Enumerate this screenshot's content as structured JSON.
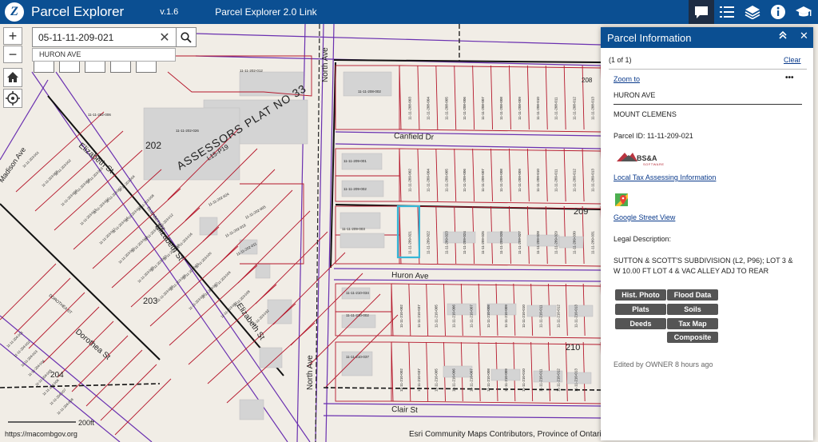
{
  "header": {
    "logo_letter": "Z",
    "title": "Parcel Explorer",
    "version": "v.1.6",
    "link_label": "Parcel Explorer 2.0 Link",
    "icons": [
      "chat-icon",
      "list-icon",
      "layers-icon",
      "info-icon",
      "graduation-cap-icon"
    ]
  },
  "search": {
    "value": "05-11-11-209-021",
    "suggestion": "HURON AVE"
  },
  "map": {
    "streets": [
      "North Ave",
      "Canfield Dr",
      "Huron Ave",
      "Clair St",
      "Elizabeth St",
      "Elizabeth St",
      "Dorothea St",
      "Madison Ave",
      "North Ave",
      "ELIZABETH ST",
      "DOROTHEA ST"
    ],
    "plat_label": "ASSESSORS PLAT NO 33",
    "plat_ref": "L15-P19",
    "block_numbers": [
      "202",
      "203",
      "204",
      "208",
      "209",
      "210"
    ],
    "scale_label": "200ft",
    "attribution_left": "https://macombgov.org",
    "attribution_right": "Esri Community Maps Contributors, Province of Ontari",
    "parcel_ids": {
      "block208": [
        "11-11-208-002",
        "11-11-208-003",
        "11-11-208-004",
        "11-11-208-005",
        "11-11-208-006",
        "11-11-208-007",
        "11-11-208-008",
        "11-11-208-009",
        "11-11-208-010",
        "11-11-208-011",
        "11-11-208-012",
        "11-11-208-013"
      ],
      "block209top": [
        "11-11-209-001",
        "11-11-209-002",
        "11-11-209-004",
        "11-11-209-005",
        "11-11-209-006",
        "11-11-209-007",
        "11-11-209-008",
        "11-11-209-009",
        "11-11-209-010",
        "11-11-209-011",
        "11-11-209-012",
        "11-11-209-013"
      ],
      "block209bottom": [
        "11-11-209-003",
        "11-11-209-021",
        "11-11-209-022",
        "11-11-209-023",
        "11-11-209-024",
        "11-11-209-025",
        "11-11-209-026",
        "11-11-209-027",
        "11-11-209-028",
        "11-11-209-029",
        "11-11-209-030",
        "11-11-209-031"
      ],
      "block210": [
        "11-11-210-034",
        "11-11-210-002",
        "11-11-210-037",
        "11-11-210-005",
        "11-11-210-006",
        "11-11-210-007",
        "11-11-210-008",
        "11-11-210-009",
        "11-11-210-010",
        "11-11-210-011",
        "11-11-210-012",
        "11-11-210-013"
      ],
      "block202": [
        "11-11-202-012",
        "11-11-202-006",
        "11-11-202-026",
        "11-11-202-024",
        "11-11-202-005",
        "11-11-202-019",
        "11-11-202-011"
      ],
      "block203": [
        "11-11-203-001",
        "11-11-203-002",
        "11-11-203-003",
        "11-11-203-004",
        "11-11-203-005",
        "11-11-203-006",
        "11-11-203-007",
        "11-11-203-008",
        "11-11-203-009",
        "11-11-203-010",
        "11-11-203-011",
        "11-11-203-012",
        "11-11-203-013",
        "11-11-203-014",
        "11-11-203-015",
        "11-11-203-016",
        "11-11-203-017",
        "11-11-203-018",
        "11-11-203-019",
        "11-11-203-020",
        "11-11-203-021",
        "11-11-203-022",
        "11-11-203-023",
        "11-11-203-024",
        "11-11-203-025",
        "11-11-203-026",
        "11-11-203-027",
        "11-11-203-028",
        "11-11-203-029",
        "11-11-203-030",
        "11-11-203-031",
        "11-11-203-032"
      ],
      "block204": [
        "11-11-204-001",
        "11-11-204-002",
        "11-11-204-003",
        "11-11-204-004",
        "11-11-204-005",
        "11-11-204-006",
        "11-11-204-007",
        "11-11-204-008"
      ]
    }
  },
  "panel": {
    "title": "Parcel Information",
    "count": "(1 of 1)",
    "clear": "Clear",
    "zoom_to": "Zoom to",
    "menu": "•••",
    "address": "HURON AVE",
    "city": "MOUNT CLEMENS",
    "parcel_id": "Parcel ID: 11-11-209-021",
    "bsa_logo": "BS&A",
    "bsa_sub": "SOFTWARE",
    "tax_link": "Local Tax Assessing Information",
    "street_view": "Google Street View",
    "legal_label": "Legal Description:",
    "legal_text": "SUTTON & SCOTT'S SUBDIVISION (L2, P96); LOT 3 & W 10.00 FT LOT 4 & VAC ALLEY ADJ TO REAR",
    "buttons": {
      "hist_photo": "Hist. Photo",
      "flood_data": "Flood Data",
      "plats": "Plats",
      "soils": "Soils",
      "deeds": "Deeds",
      "tax_map": "Tax Map",
      "composite": "Composite"
    },
    "edited": "Edited by OWNER 8 hours ago"
  },
  "colors": {
    "header": "#0b4f92",
    "parcel_line": "#b5172b",
    "road_line": "#6a30b0",
    "block_line": "#111111",
    "selected": "#37b6d6",
    "building": "#d4d4d4",
    "land": "#f1ede6"
  }
}
